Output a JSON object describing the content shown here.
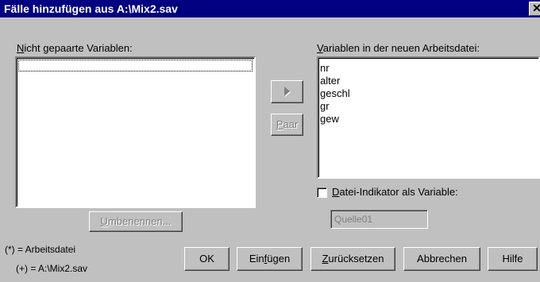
{
  "window": {
    "title": "Fälle hinzufügen aus A:\\Mix2.sav",
    "close_glyph": "✕"
  },
  "left_panel": {
    "label_first": "N",
    "label_rest": "icht gepaarte Variablen:",
    "items": []
  },
  "right_panel": {
    "label_first": "V",
    "label_rest": "ariablen in der neuen Arbeitsdatei:",
    "items": [
      "nr",
      "alter",
      "geschl",
      "gr",
      "gew"
    ]
  },
  "middle": {
    "move_icon": "right-triangle-icon",
    "pair_label_first": "P",
    "pair_label_rest": "aar"
  },
  "rename_button": {
    "label_first": "U",
    "label_rest": "mbenennen..."
  },
  "indicator": {
    "label_first": "D",
    "label_rest": "atei-Indikator als Variable:",
    "checked": false,
    "field_value": "Quelle01"
  },
  "legend": {
    "line1": "(*) = Arbeitsdatei",
    "line2": "(+) = A:\\Mix2.sav"
  },
  "buttons": {
    "ok": "OK",
    "paste_first": "Ein",
    "paste_u": "f",
    "paste_rest": "ügen",
    "reset_first": "Z",
    "reset_rest": "urücksetzen",
    "cancel": "Abbrechen",
    "help": "Hilfe"
  },
  "colors": {
    "titlebar": "#000080",
    "face": "#c0c0c0",
    "disabled_text": "#808080"
  }
}
